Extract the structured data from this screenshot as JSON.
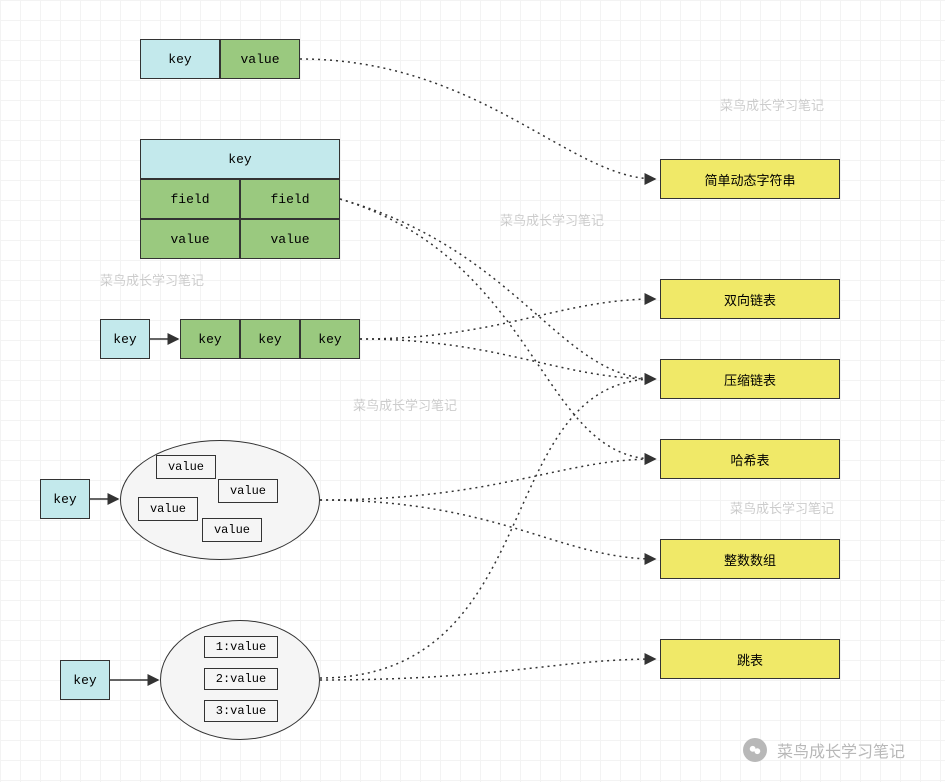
{
  "colors": {
    "cyan": "#c3e9ec",
    "green": "#9ac97f",
    "yellow": "#f0e968",
    "gray": "#f5f5f5",
    "border": "#333333",
    "watermark": "#cccccc"
  },
  "watermark_text": "菜鸟成长学习笔记",
  "string_type": {
    "key_label": "key",
    "value_label": "value"
  },
  "hash_type": {
    "key_label": "key",
    "fields": [
      "field",
      "field"
    ],
    "values": [
      "value",
      "value"
    ]
  },
  "list_type": {
    "key_label": "key",
    "items": [
      "key",
      "key",
      "key"
    ]
  },
  "set_type": {
    "key_label": "key",
    "values": [
      "value",
      "value",
      "value",
      "value"
    ]
  },
  "zset_type": {
    "key_label": "key",
    "entries": [
      "1:value",
      "2:value",
      "3:value"
    ]
  },
  "targets": {
    "sds": "简单动态字符串",
    "linkedlist": "双向链表",
    "ziplist": "压缩链表",
    "hashtable": "哈希表",
    "intset": "整数数组",
    "skiplist": "跳表"
  },
  "footer": "菜鸟成长学习笔记"
}
